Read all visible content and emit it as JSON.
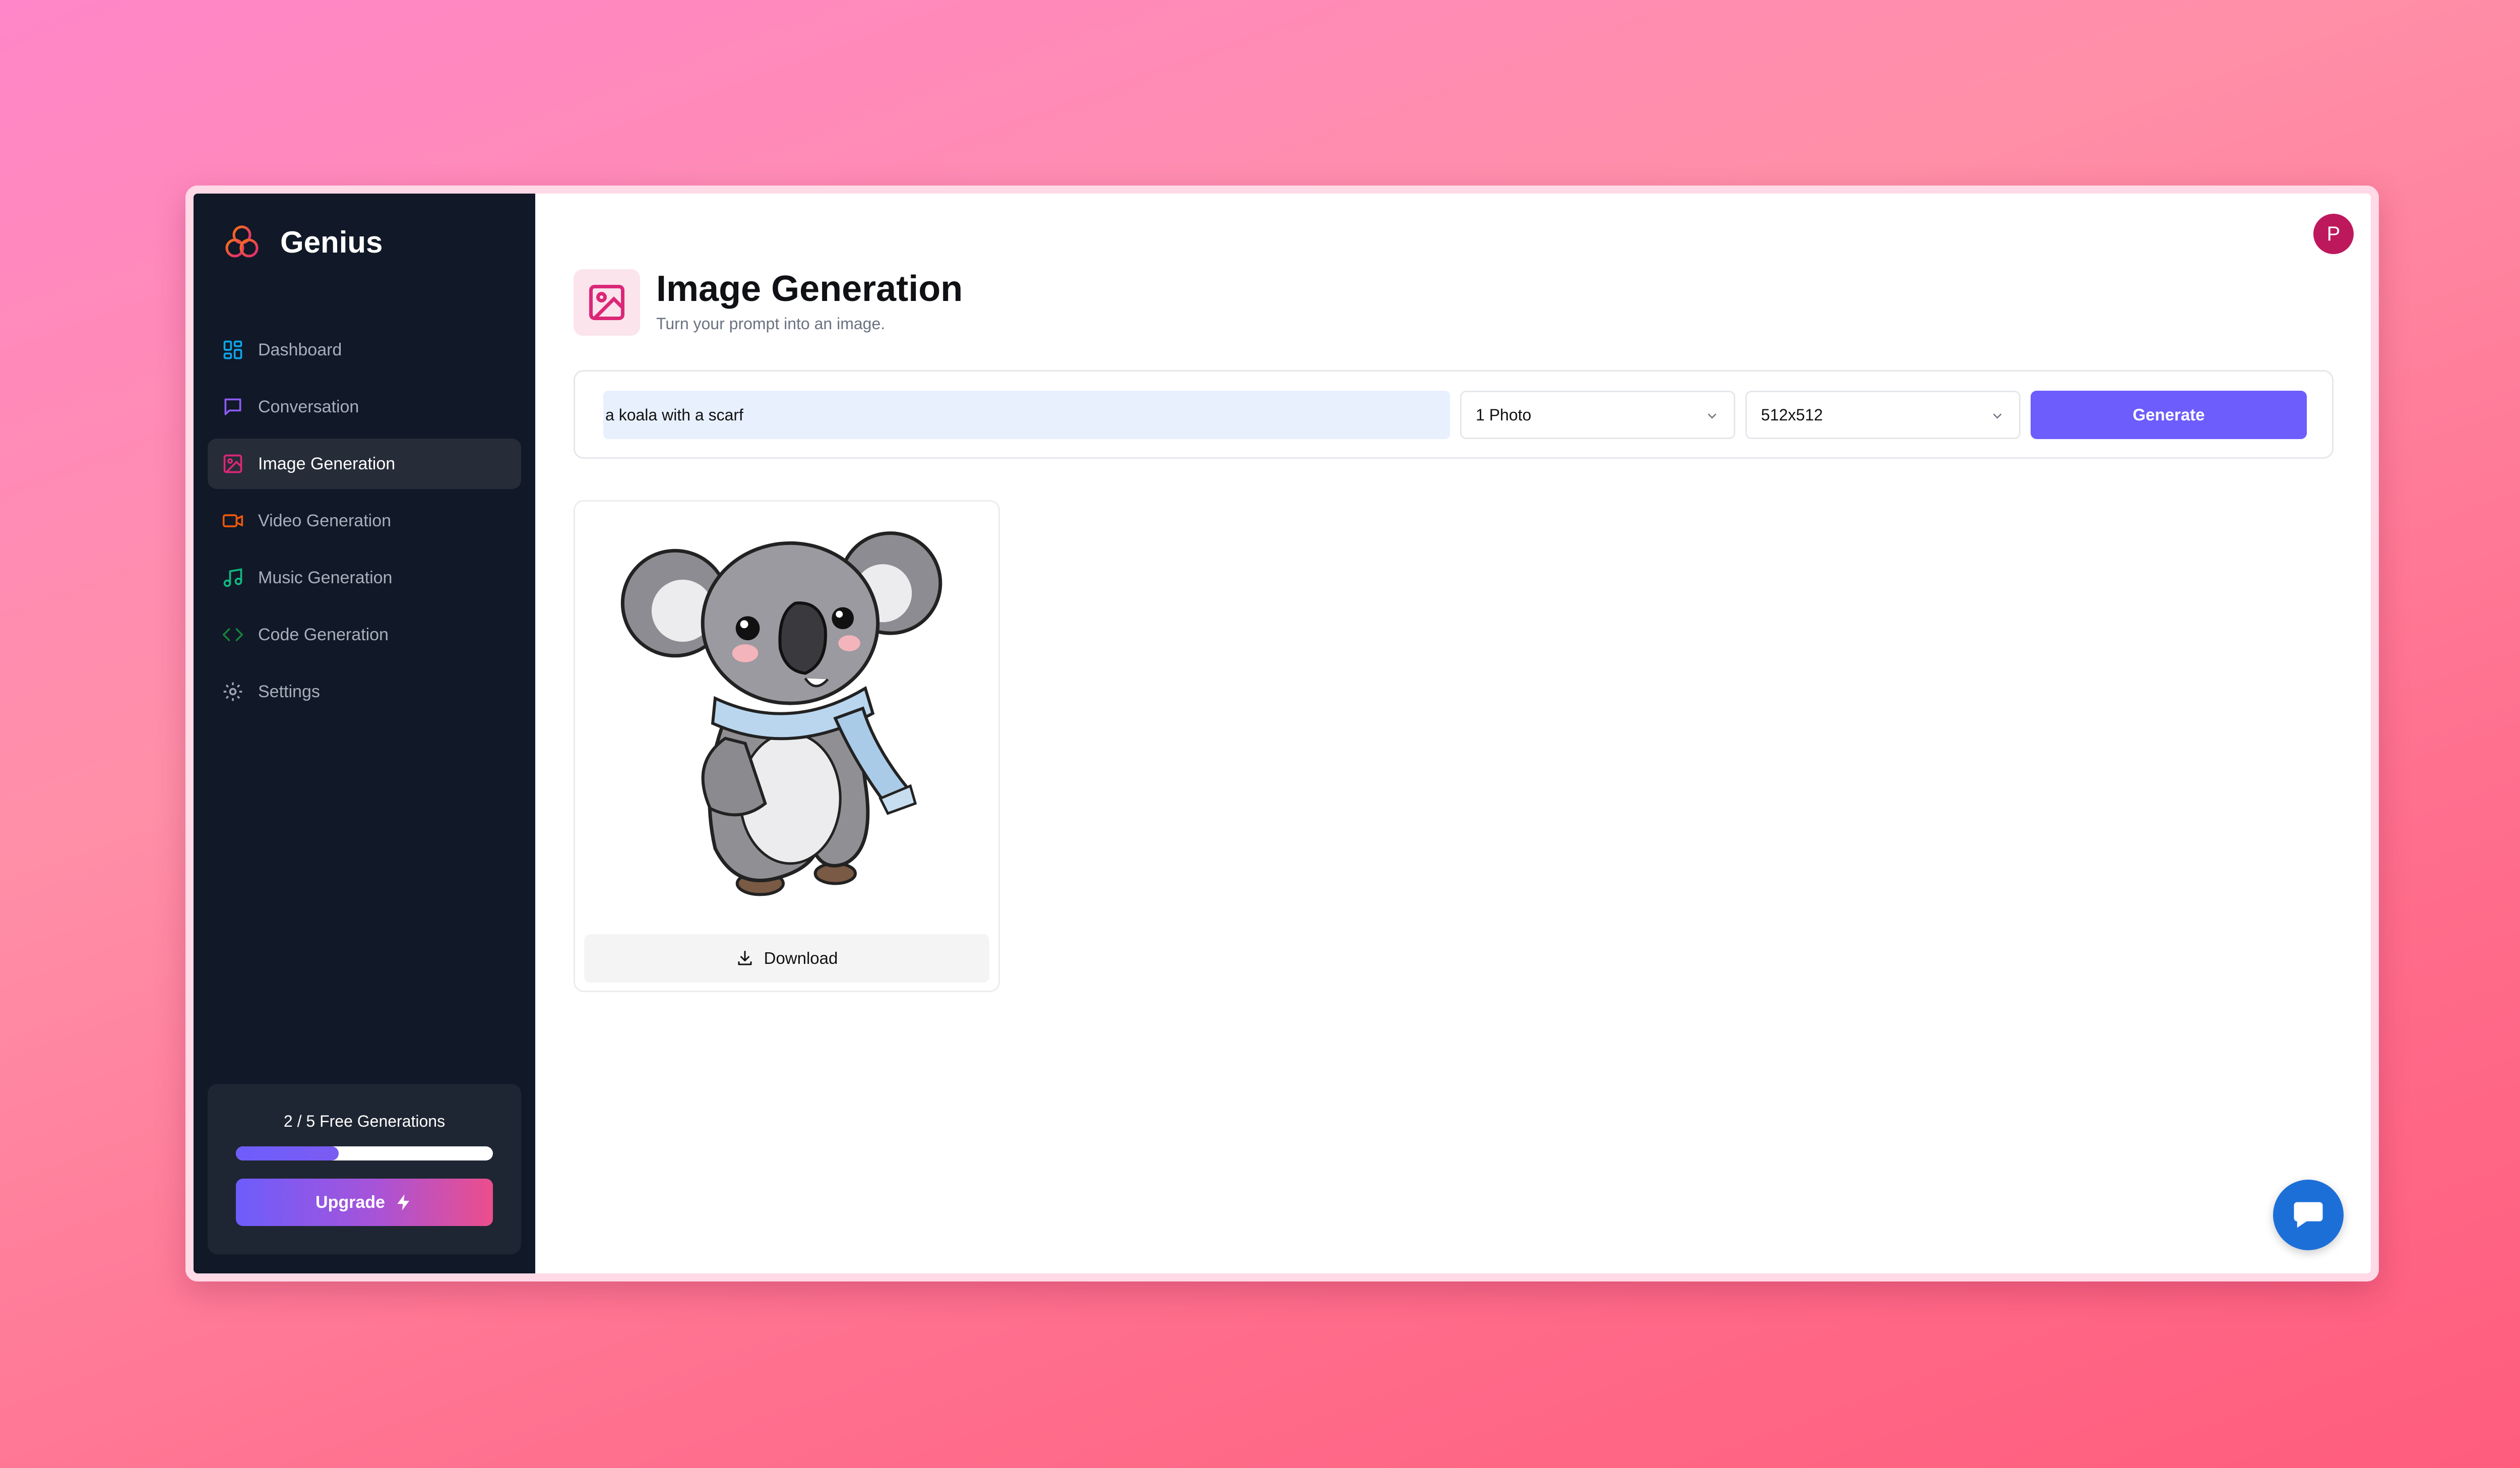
{
  "brand": {
    "name": "Genius",
    "icon": "three-circles-logo"
  },
  "sidebar": {
    "items": [
      {
        "label": "Dashboard",
        "icon": "dashboard-icon",
        "color": "#0ea5e9"
      },
      {
        "label": "Conversation",
        "icon": "chat-bubble-icon",
        "color": "#8b5cf6"
      },
      {
        "label": "Image Generation",
        "icon": "image-icon",
        "color": "#db2777",
        "active": true
      },
      {
        "label": "Video Generation",
        "icon": "video-icon",
        "color": "#ea580c"
      },
      {
        "label": "Music Generation",
        "icon": "music-note-icon",
        "color": "#10b981"
      },
      {
        "label": "Code Generation",
        "icon": "code-brackets-icon",
        "color": "#15803d"
      },
      {
        "label": "Settings",
        "icon": "gear-icon",
        "color": "#9ca3af"
      }
    ],
    "free_counter": {
      "text": "2 / 5 Free Generations",
      "used": 2,
      "limit": 5,
      "upgrade_label": "Upgrade",
      "upgrade_icon": "lightning-icon"
    }
  },
  "header": {
    "avatar_initial": "P",
    "avatar_color": "#be185d"
  },
  "page": {
    "icon": "image-icon",
    "title": "Image Generation",
    "subtitle": "Turn your prompt into an image."
  },
  "form": {
    "prompt_value": "a koala with a scarf",
    "amount_selected": "1 Photo",
    "resolution_selected": "512x512",
    "generate_label": "Generate"
  },
  "results": [
    {
      "image": "koala-with-scarf-illustration",
      "download_label": "Download"
    }
  ],
  "colors": {
    "accent": "#6d5dfc",
    "sidebar_bg": "#111827",
    "chat_button": "#1d6fd8"
  }
}
